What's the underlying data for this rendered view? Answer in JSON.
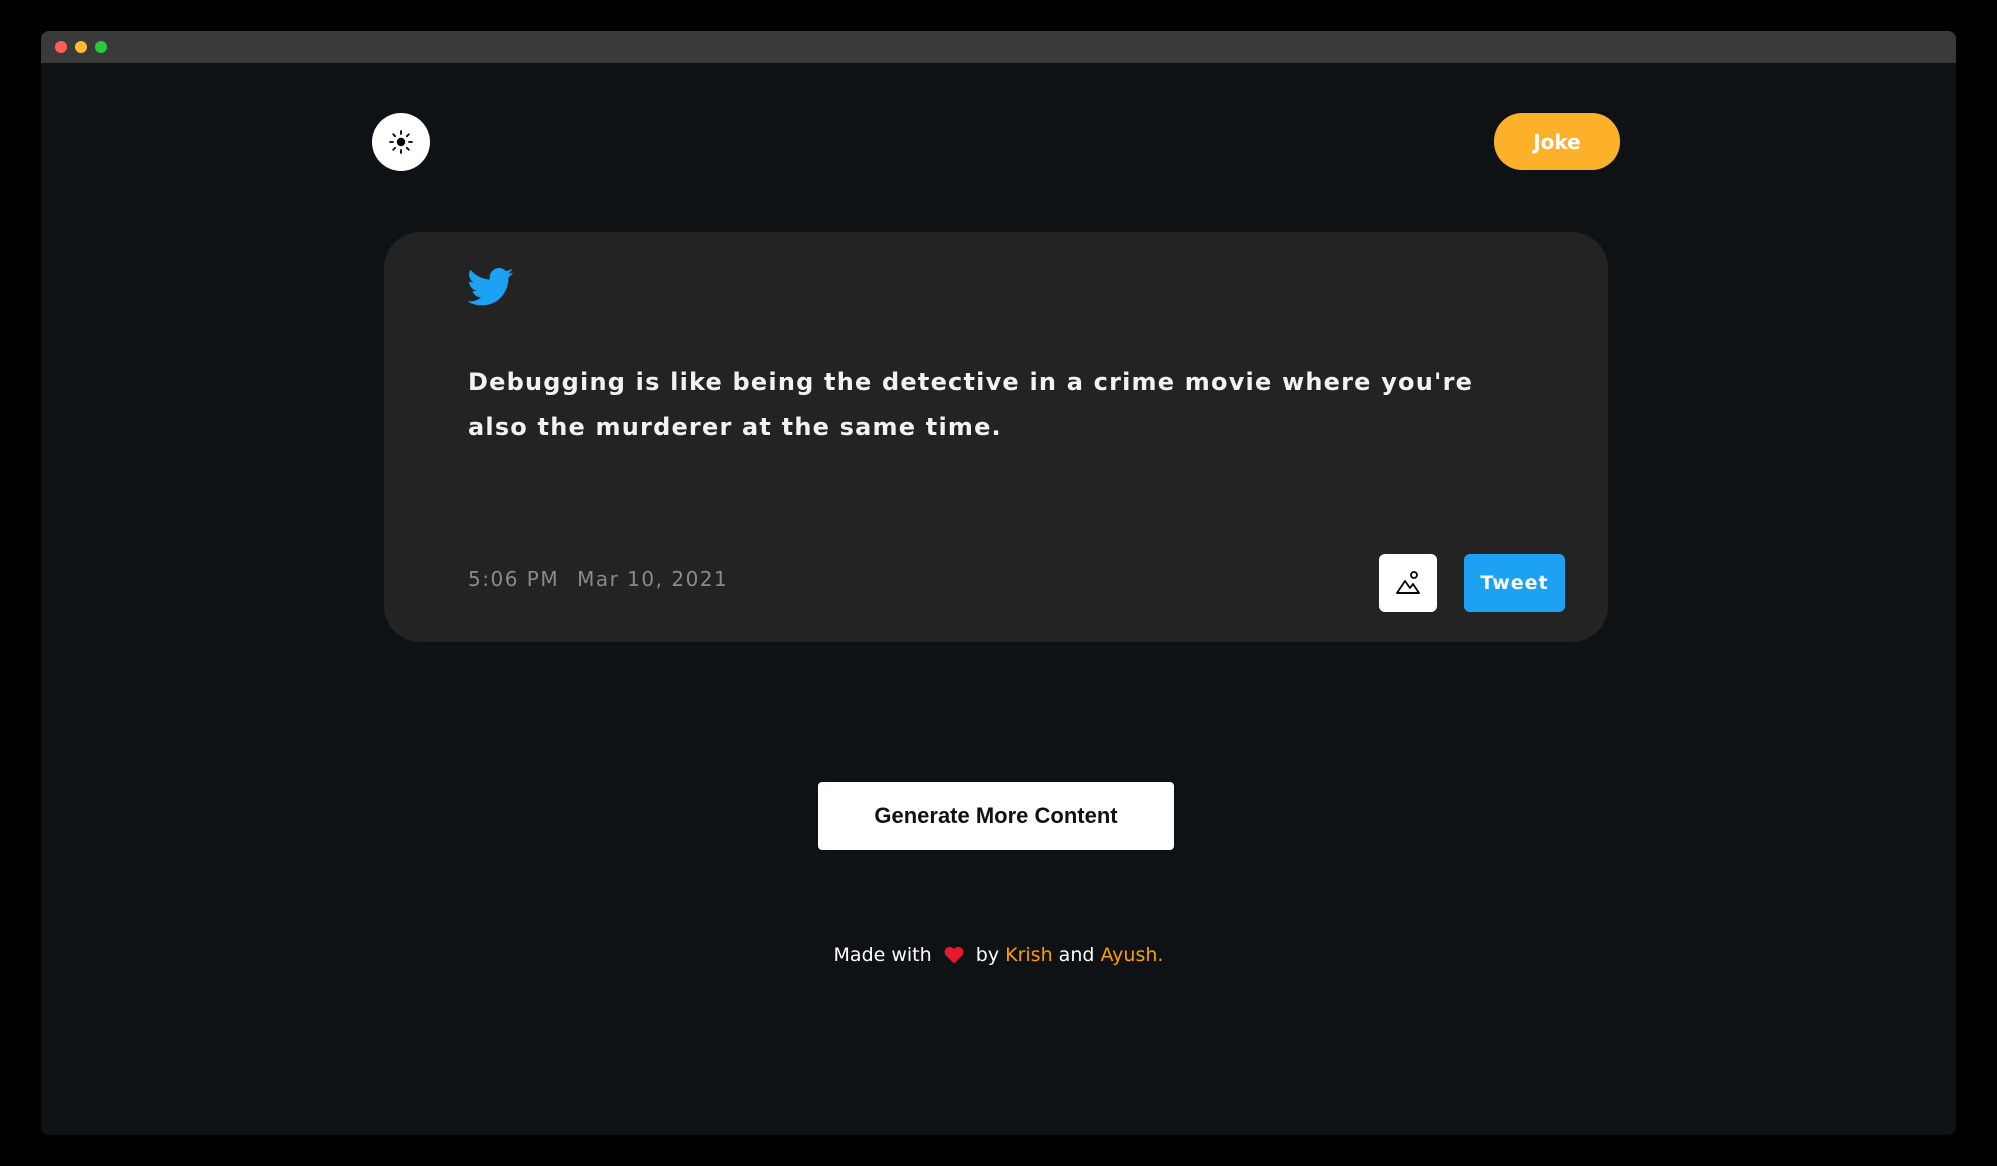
{
  "header": {
    "mode_label": "Joke"
  },
  "tweet": {
    "text": "Debugging is like being the detective in a crime movie where you're also the murderer at the same time.",
    "time": "5:06 PM",
    "date": "Mar 10, 2021",
    "tweet_label": "Tweet"
  },
  "actions": {
    "generate_label": "Generate More Content"
  },
  "footer": {
    "made_with": "Made with",
    "by": "by",
    "author1": "Krish",
    "and": "and",
    "author2": "Ayush."
  },
  "colors": {
    "accent_orange": "#fdb02a",
    "twitter_blue": "#1da1f2",
    "heart_red": "#e61a2c",
    "link_orange": "#ff9d00"
  }
}
